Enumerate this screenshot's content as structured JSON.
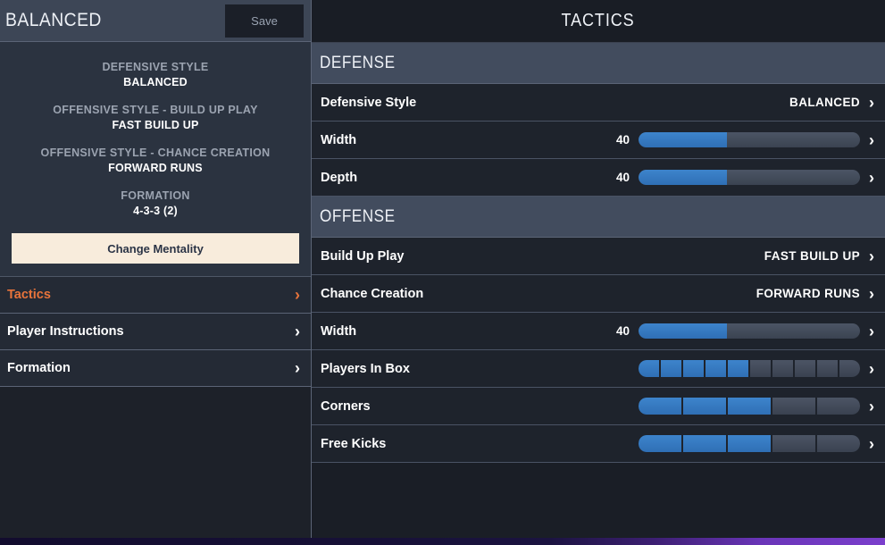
{
  "sidebar": {
    "title": "BALANCED",
    "save_label": "Save",
    "summary": [
      {
        "label": "DEFENSIVE STYLE",
        "value": "BALANCED"
      },
      {
        "label": "OFFENSIVE STYLE - BUILD UP PLAY",
        "value": "FAST BUILD UP"
      },
      {
        "label": "OFFENSIVE STYLE - CHANCE CREATION",
        "value": "FORWARD RUNS"
      },
      {
        "label": "FORMATION",
        "value": "4-3-3 (2)"
      }
    ],
    "change_mentality_label": "Change Mentality",
    "nav": [
      {
        "label": "Tactics",
        "active": true
      },
      {
        "label": "Player Instructions",
        "active": false
      },
      {
        "label": "Formation",
        "active": false
      }
    ]
  },
  "main": {
    "title": "TACTICS",
    "sections": [
      {
        "heading": "DEFENSE",
        "rows": [
          {
            "label": "Defensive Style",
            "control": "value",
            "value": "BALANCED"
          },
          {
            "label": "Width",
            "control": "slider",
            "value": "40",
            "percent": 40
          },
          {
            "label": "Depth",
            "control": "slider",
            "value": "40",
            "percent": 40
          }
        ]
      },
      {
        "heading": "OFFENSE",
        "rows": [
          {
            "label": "Build Up Play",
            "control": "value",
            "value": "FAST BUILD UP"
          },
          {
            "label": "Chance Creation",
            "control": "value",
            "value": "FORWARD RUNS"
          },
          {
            "label": "Width",
            "control": "slider",
            "value": "40",
            "percent": 40
          },
          {
            "label": "Players In Box",
            "control": "segments",
            "segments": 10,
            "filled": 5
          },
          {
            "label": "Corners",
            "control": "segments",
            "segments": 5,
            "filled": 3
          },
          {
            "label": "Free Kicks",
            "control": "segments",
            "segments": 5,
            "filled": 3
          }
        ]
      }
    ]
  },
  "icons": {
    "chevron_right": "›"
  },
  "colors": {
    "accent_orange": "#e8743b",
    "slider_blue": "#3d84cc",
    "section_header": "#424c5e",
    "cream_button": "#f8ecdc"
  }
}
